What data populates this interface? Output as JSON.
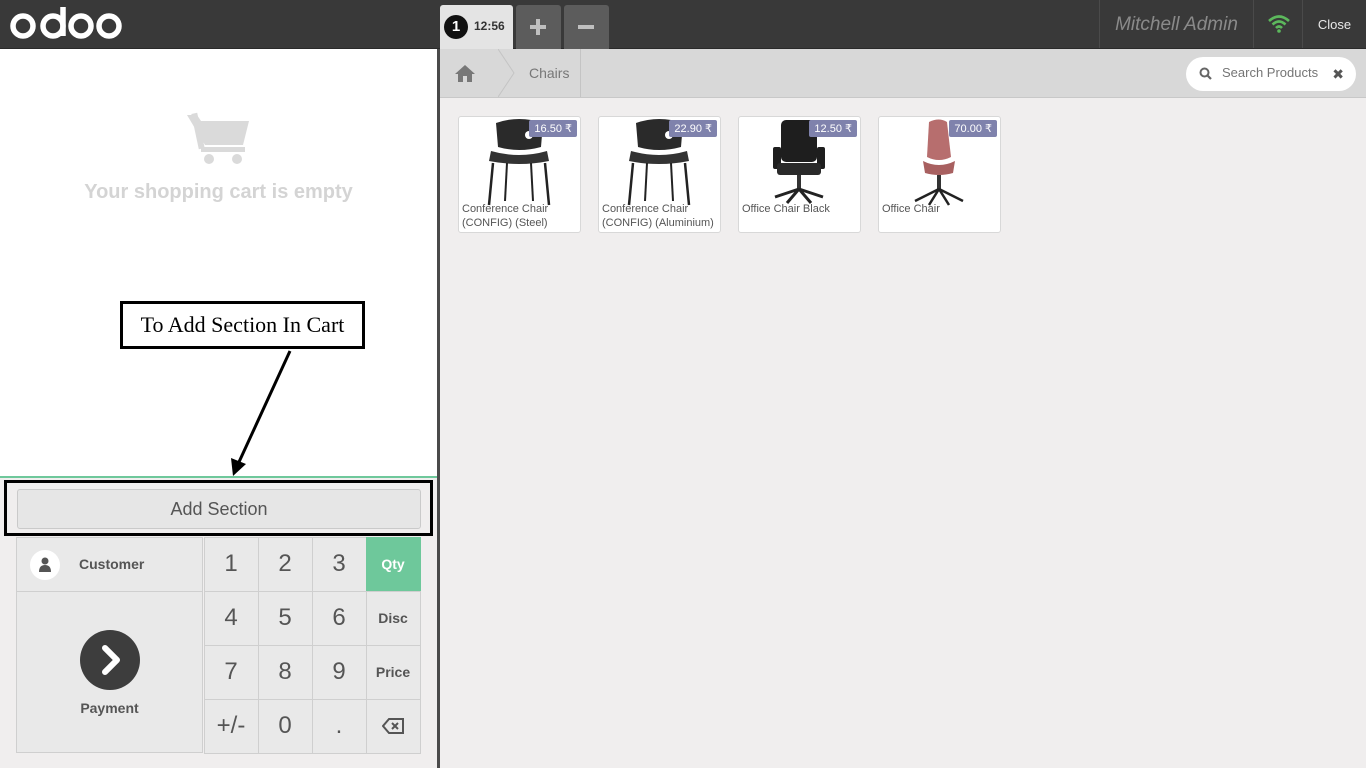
{
  "topbar": {
    "brand": "odoo",
    "order_number": "1",
    "order_time": "12:56",
    "username": "Mitchell Admin",
    "close_label": "Close"
  },
  "cart": {
    "empty_message": "Your shopping cart is empty"
  },
  "annotation": {
    "text": "To Add Section In Cart"
  },
  "controls": {
    "add_section_label": "Add Section",
    "customer_label": "Customer",
    "payment_label": "Payment",
    "keys": [
      "1",
      "2",
      "3",
      "Qty",
      "4",
      "5",
      "6",
      "Disc",
      "7",
      "8",
      "9",
      "Price",
      "+/-",
      "0",
      ".",
      ""
    ],
    "selected_mode": "Qty"
  },
  "breadcrumb": {
    "category": "Chairs"
  },
  "search": {
    "placeholder": "Search Products"
  },
  "products": [
    {
      "name": "Conference Chair (CONFIG) (Steel)",
      "price": "16.50 ₹"
    },
    {
      "name": "Conference Chair (CONFIG) (Aluminium)",
      "price": "22.90 ₹"
    },
    {
      "name": "Office Chair Black",
      "price": "12.50 ₹"
    },
    {
      "name": "Office Chair",
      "price": "70.00 ₹"
    }
  ],
  "colors": {
    "accent": "#6ec89b",
    "price_badge": "#7f82ac",
    "topbar": "#393939",
    "wifi": "#5cb85c"
  }
}
